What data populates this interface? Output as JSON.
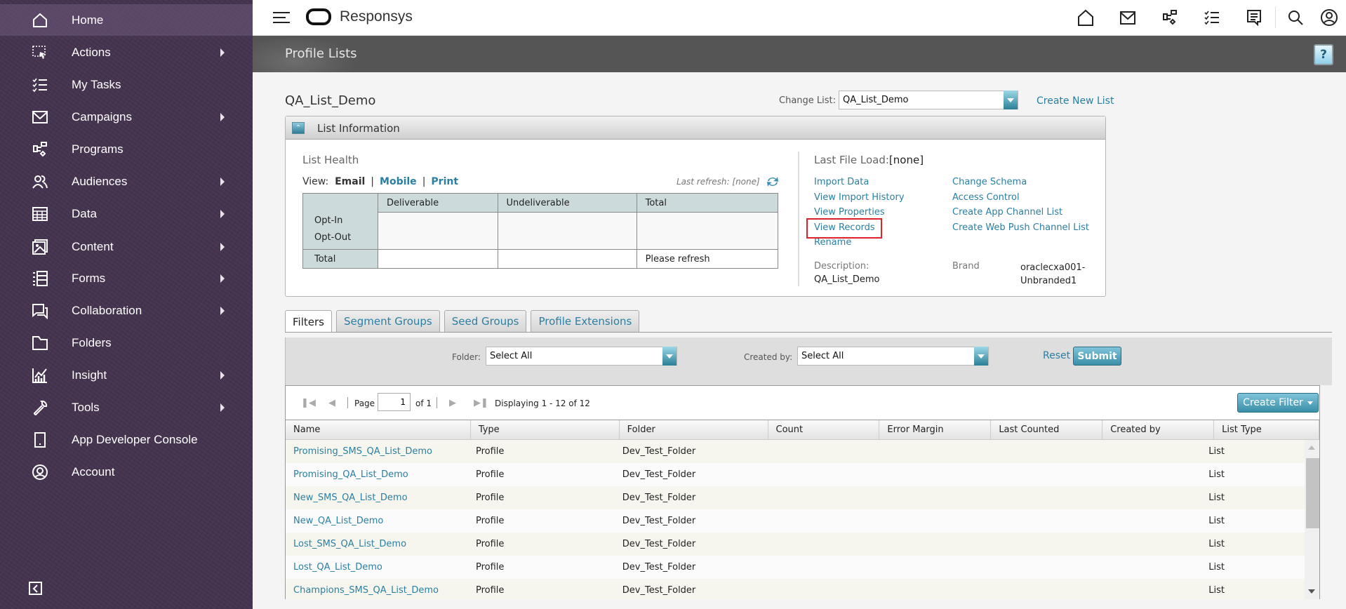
{
  "sidebar": {
    "items": [
      {
        "label": "Home",
        "icon": "home-icon",
        "submenu": false,
        "active": true
      },
      {
        "label": "Actions",
        "icon": "actions-icon",
        "submenu": true
      },
      {
        "label": "My Tasks",
        "icon": "tasks-icon",
        "submenu": false
      },
      {
        "label": "Campaigns",
        "icon": "mail-icon",
        "submenu": true
      },
      {
        "label": "Programs",
        "icon": "programs-icon",
        "submenu": false
      },
      {
        "label": "Audiences",
        "icon": "users-icon",
        "submenu": true
      },
      {
        "label": "Data",
        "icon": "table-icon",
        "submenu": true
      },
      {
        "label": "Content",
        "icon": "image-icon",
        "submenu": true
      },
      {
        "label": "Forms",
        "icon": "forms-icon",
        "submenu": true
      },
      {
        "label": "Collaboration",
        "icon": "chat-icon",
        "submenu": true
      },
      {
        "label": "Folders",
        "icon": "folder-icon",
        "submenu": false
      },
      {
        "label": "Insight",
        "icon": "chart-icon",
        "submenu": true
      },
      {
        "label": "Tools",
        "icon": "wrench-icon",
        "submenu": true
      },
      {
        "label": "App Developer Console",
        "icon": "mobile-icon",
        "submenu": false
      },
      {
        "label": "Account",
        "icon": "account-icon",
        "submenu": false
      }
    ]
  },
  "header": {
    "brand": "Responsys",
    "icons": [
      "home-icon",
      "mail-icon",
      "programs-icon",
      "tasks-icon",
      "notes-icon",
      "search-icon",
      "profile-icon"
    ]
  },
  "page": {
    "title": "Profile Lists",
    "help_label": "?",
    "list_name": "QA_List_Demo",
    "change_list_label": "Change List:",
    "change_list_value": "QA_List_Demo",
    "create_new_list": "Create New List"
  },
  "list_info": {
    "title": "List Information",
    "health_title": "List Health",
    "view_label": "View:",
    "view_email": "Email",
    "view_mobile": "Mobile",
    "view_print": "Print",
    "view_sep": "|",
    "last_refresh": "Last refresh: [none]",
    "table": {
      "headers": [
        "",
        "Deliverable",
        "Undeliverable",
        "Total"
      ],
      "opt_in": "Opt-In",
      "opt_out": "Opt-Out",
      "total_label": "Total",
      "total_value": "Please refresh"
    },
    "last_file_load_label": "Last File Load:",
    "last_file_load_value": "[none]",
    "actions_left": [
      "Import Data",
      "View Import History",
      "View Properties",
      "View Records",
      "Rename"
    ],
    "actions_right": [
      "Change Schema",
      "Access Control",
      "Create App Channel List",
      "Create Web Push Channel List"
    ],
    "description_label": "Description:",
    "description_value": "QA_List_Demo",
    "brand_label": "Brand",
    "brand_value_1": "oraclecxa001-",
    "brand_value_2": "Unbranded1"
  },
  "tabs": [
    {
      "label": "Filters",
      "active": true
    },
    {
      "label": "Segment Groups"
    },
    {
      "label": "Seed Groups"
    },
    {
      "label": "Profile Extensions"
    }
  ],
  "filters": {
    "folder_label": "Folder:",
    "folder_value": "Select All",
    "created_by_label": "Created by:",
    "created_by_value": "Select All",
    "reset": "Reset",
    "submit": "Submit"
  },
  "grid": {
    "page_label": "Page",
    "page_value": "1",
    "of_label": "of 1",
    "displaying": "Displaying 1 - 12 of 12",
    "create_filter": "Create Filter",
    "columns": [
      "Name",
      "Type",
      "Folder",
      "Count",
      "Error Margin",
      "Last Counted",
      "Created by",
      "List Type"
    ],
    "rows": [
      [
        "Promising_SMS_QA_List_Demo",
        "Profile",
        "Dev_Test_Folder",
        "",
        "",
        "",
        "",
        "List"
      ],
      [
        "Promising_QA_List_Demo",
        "Profile",
        "Dev_Test_Folder",
        "",
        "",
        "",
        "",
        "List"
      ],
      [
        "New_SMS_QA_List_Demo",
        "Profile",
        "Dev_Test_Folder",
        "",
        "",
        "",
        "",
        "List"
      ],
      [
        "New_QA_List_Demo",
        "Profile",
        "Dev_Test_Folder",
        "",
        "",
        "",
        "",
        "List"
      ],
      [
        "Lost_SMS_QA_List_Demo",
        "Profile",
        "Dev_Test_Folder",
        "",
        "",
        "",
        "",
        "List"
      ],
      [
        "Lost_QA_List_Demo",
        "Profile",
        "Dev_Test_Folder",
        "",
        "",
        "",
        "",
        "List"
      ],
      [
        "Champions_SMS_QA_List_Demo",
        "Profile",
        "Dev_Test_Folder",
        "",
        "",
        "",
        "",
        "List"
      ]
    ]
  },
  "colors": {
    "sidebar": "#45344f",
    "link": "#2a7fa2",
    "title_bar": "#555555",
    "highlight_box": "#e0202a"
  }
}
